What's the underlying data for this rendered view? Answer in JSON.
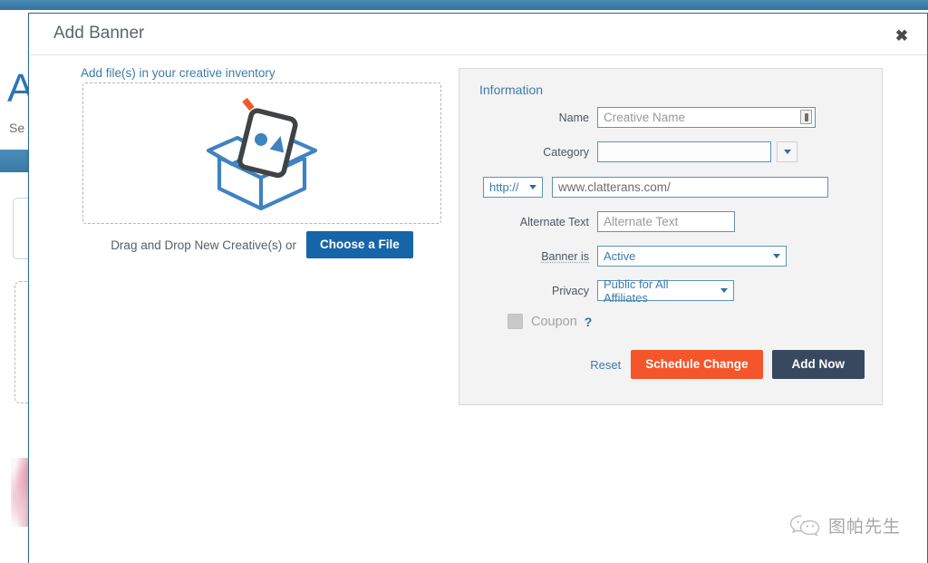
{
  "background": {
    "heading_letter": "A",
    "sub_text": "Se",
    "topbar_color": "#3b7ba6"
  },
  "modal": {
    "title": "Add Banner",
    "close_label": "✖",
    "upload": {
      "section_label": "Add file(s) in your creative inventory",
      "caption": "Drag and Drop New Creative(s) or",
      "choose_file_label": "Choose a File",
      "illustration_name": "open-box-with-image-card"
    },
    "information": {
      "title": "Information",
      "fields": {
        "name": {
          "label": "Name",
          "value": "",
          "placeholder": "Creative Name"
        },
        "category": {
          "label": "Category",
          "value": "",
          "placeholder": ""
        },
        "url": {
          "scheme_value": "http://",
          "value": "www.clatterans.com/",
          "placeholder": "www.clatterans.com/"
        },
        "alternate_text": {
          "label": "Alternate Text",
          "value": "",
          "placeholder": "Alternate Text"
        },
        "banner_status": {
          "label": "Banner is",
          "value": "Active"
        },
        "privacy": {
          "label": "Privacy",
          "value": "Public for All Affiliates"
        },
        "coupon": {
          "label": "Coupon",
          "help": "?",
          "checked": false
        }
      },
      "actions": {
        "reset_label": "Reset",
        "schedule_label": "Schedule Change",
        "add_now_label": "Add Now",
        "schedule_color": "#f4552a",
        "add_now_color": "#38485e"
      }
    }
  },
  "watermark": {
    "text": "图帕先生",
    "icon": "wechat-icon"
  }
}
